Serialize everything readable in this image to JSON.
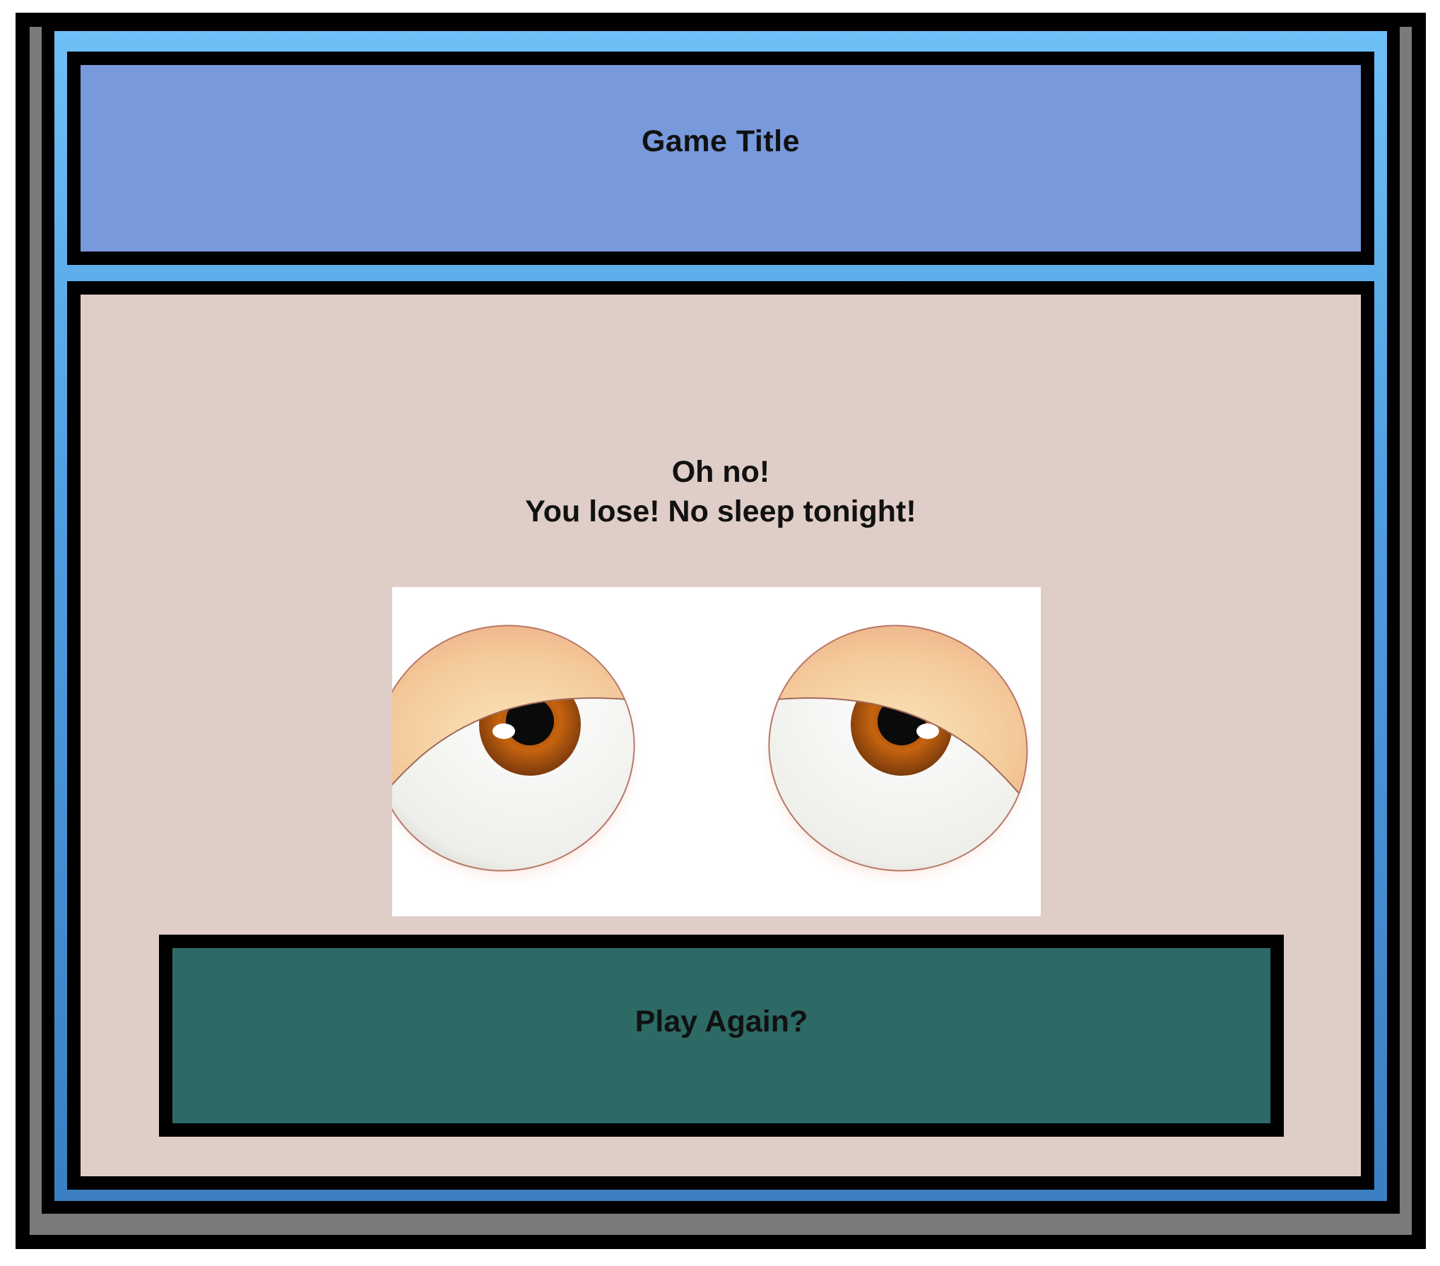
{
  "header": {
    "title": "Game Title"
  },
  "result": {
    "line1": "Oh no!",
    "line2": "You lose! No sleep tonight!"
  },
  "image": {
    "icon": "sleepy-eyes-icon"
  },
  "actions": {
    "play_again_label": "Play Again?"
  },
  "colors": {
    "title_panel": "#7899dc",
    "main_panel": "#dfcdc7",
    "play_again_button": "#2d6a65",
    "screen_gradient_top": "#6fbff7",
    "screen_gradient_bottom": "#3b7fc2",
    "frame": "#000000",
    "device_body": "#7a7a7a"
  }
}
